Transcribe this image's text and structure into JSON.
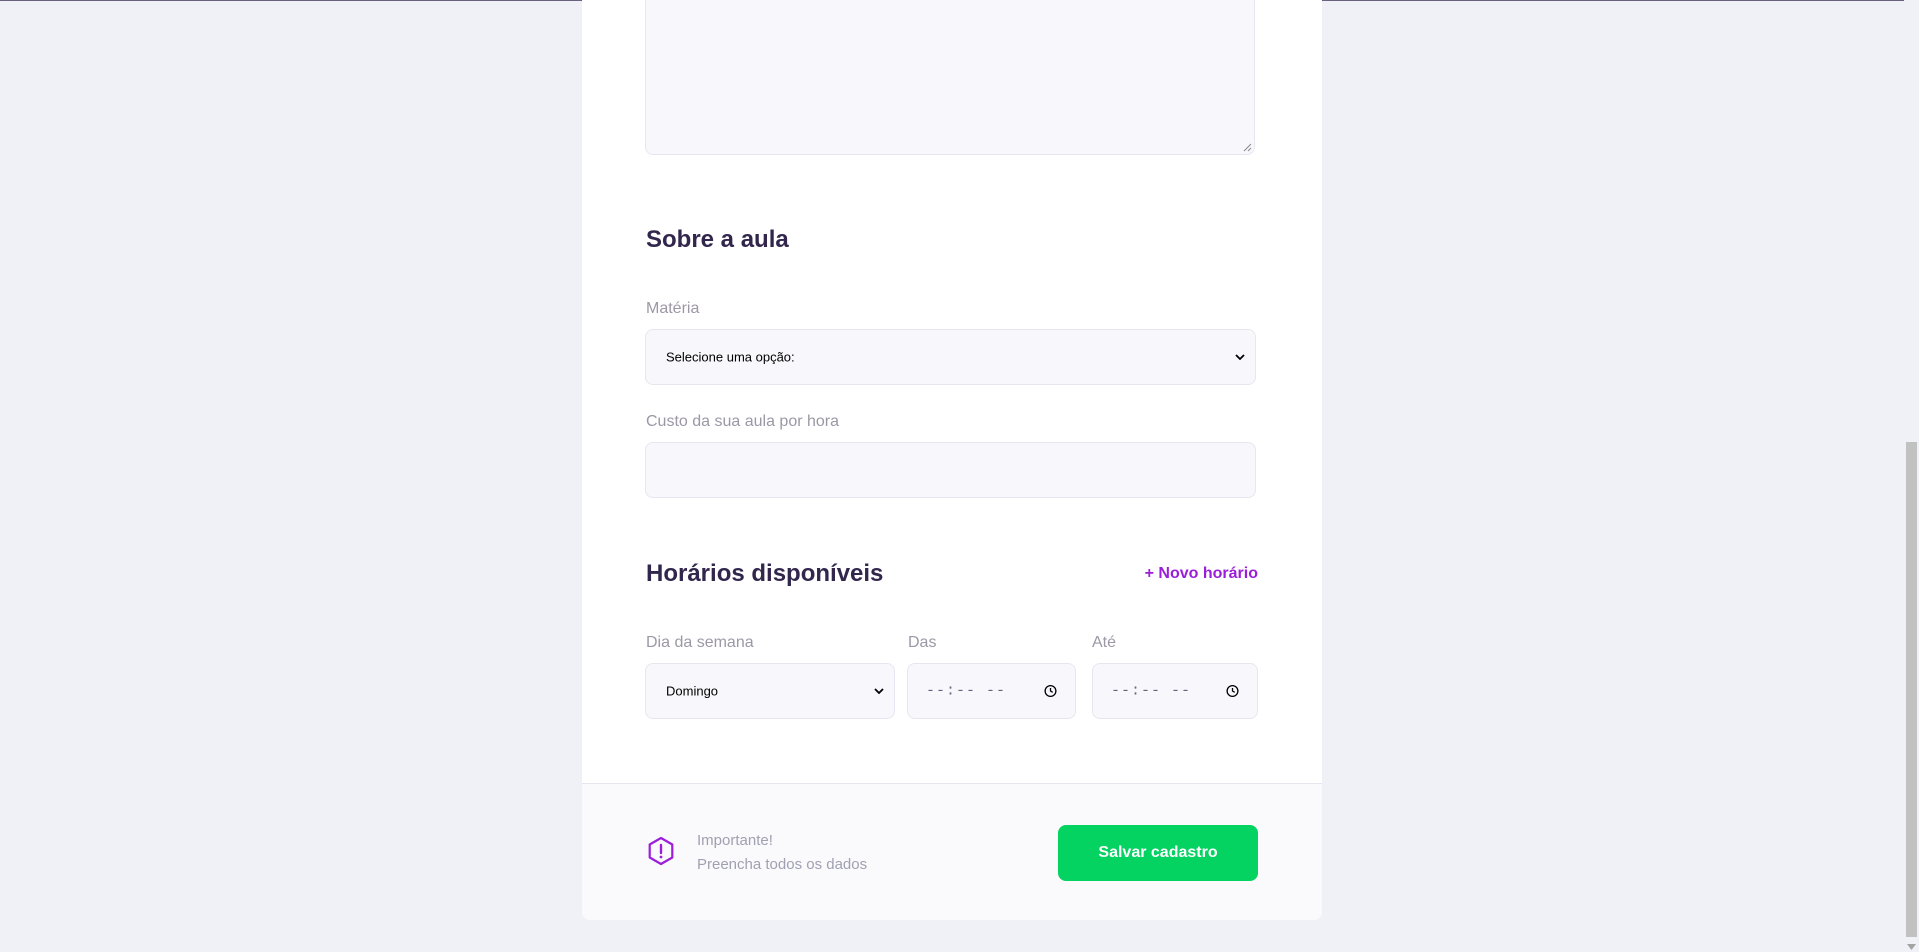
{
  "about_class": {
    "title": "Sobre a aula",
    "subject_label": "Matéria",
    "subject_selected": "Selecione uma opção:",
    "cost_label": "Custo da sua aula por hora",
    "cost_value": ""
  },
  "schedule": {
    "title": "Horários disponíveis",
    "new_time_label": "+ Novo horário",
    "weekday_label": "Dia da semana",
    "weekday_selected": "Domingo",
    "from_label": "Das",
    "from_value": "--:-- --",
    "to_label": "Até",
    "to_value": "--:-- --"
  },
  "footer": {
    "warning_title": "Importante!",
    "warning_text": "Preencha todos os dados",
    "save_label": "Salvar cadastro"
  },
  "colors": {
    "background": "#f0f0f7",
    "title": "#32264d",
    "accent": "#9b1ed9",
    "save_button": "#04d361"
  },
  "icons": [
    "chevron-down-icon",
    "clock-icon",
    "warning-icon"
  ]
}
